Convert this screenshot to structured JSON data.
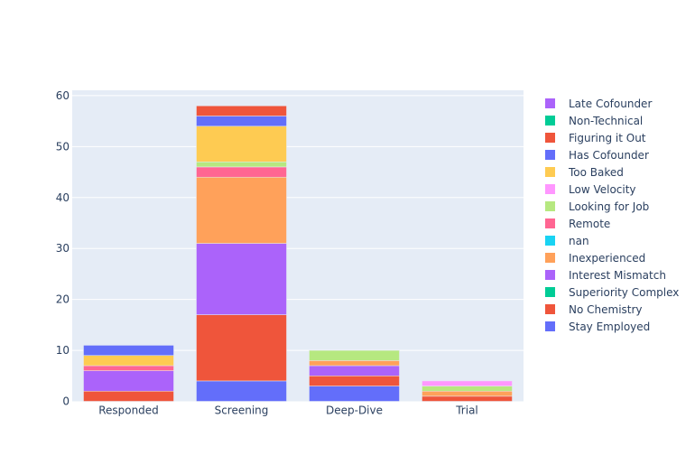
{
  "chart_data": {
    "type": "bar",
    "barmode": "stack",
    "title": "",
    "xlabel": "",
    "ylabel": "",
    "categories": [
      "Responded",
      "Screening",
      "Deep-Dive",
      "Trial"
    ],
    "ylim": [
      0,
      61
    ],
    "yticks": [
      0,
      10,
      20,
      30,
      40,
      50,
      60
    ],
    "grid": true,
    "legend_position": "right",
    "series": [
      {
        "name": "Stay Employed",
        "color": "#636efa",
        "values": [
          0,
          4,
          3,
          0
        ]
      },
      {
        "name": "No Chemistry",
        "color": "#EF553B",
        "values": [
          2,
          13,
          2,
          1
        ]
      },
      {
        "name": "Superiority Complex",
        "color": "#00cc96",
        "values": [
          0,
          0,
          0,
          0
        ]
      },
      {
        "name": "Interest Mismatch",
        "color": "#ab63fa",
        "values": [
          4,
          14,
          2,
          0
        ]
      },
      {
        "name": "Inexperienced",
        "color": "#FFA15A",
        "values": [
          0,
          13,
          1,
          1
        ]
      },
      {
        "name": "nan",
        "color": "#19d3f3",
        "values": [
          0,
          0,
          0,
          0
        ]
      },
      {
        "name": "Remote",
        "color": "#FF6692",
        "values": [
          1,
          2,
          0,
          0
        ]
      },
      {
        "name": "Looking for Job",
        "color": "#B6E880",
        "values": [
          0,
          1,
          2,
          1
        ]
      },
      {
        "name": "Low Velocity",
        "color": "#FF97FF",
        "values": [
          0,
          0,
          0,
          1
        ]
      },
      {
        "name": "Too Baked",
        "color": "#FECB52",
        "values": [
          2,
          7,
          0,
          0
        ]
      },
      {
        "name": "Has Cofounder",
        "color": "#636efa",
        "values": [
          2,
          2,
          0,
          0
        ]
      },
      {
        "name": "Figuring it Out",
        "color": "#EF553B",
        "values": [
          0,
          2,
          0,
          0
        ]
      },
      {
        "name": "Non-Technical",
        "color": "#00cc96",
        "values": [
          0,
          0,
          0,
          0
        ]
      },
      {
        "name": "Late Cofounder",
        "color": "#ab63fa",
        "values": [
          0,
          0,
          0,
          0
        ]
      }
    ],
    "plot_background": "#E5ECF6",
    "gridline_color": "#ffffff",
    "text_color": "#2a3f5f"
  }
}
